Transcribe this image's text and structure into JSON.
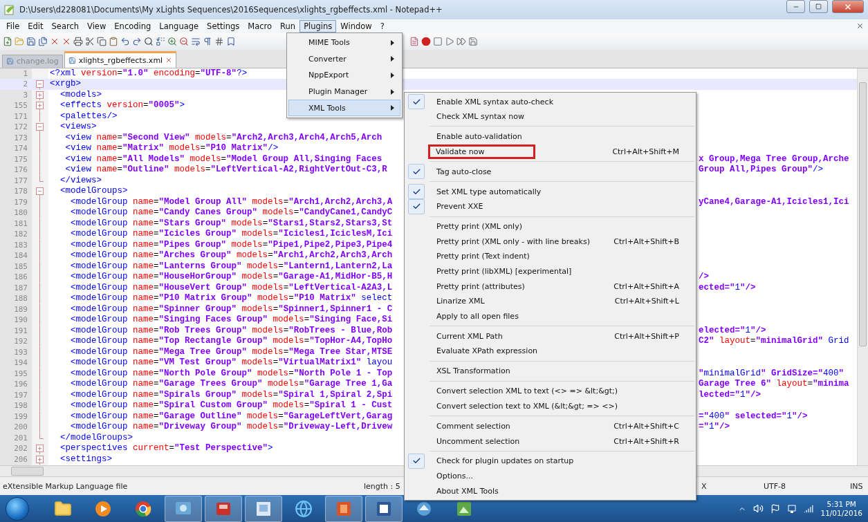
{
  "window": {
    "title": "D:\\Users\\d228081\\Documents\\My xLights Sequences\\2016Sequences\\xlights_rgbeffects.xml - Notepad++"
  },
  "menu_bar": [
    {
      "label": "File",
      "selected": false
    },
    {
      "label": "Edit",
      "selected": false
    },
    {
      "label": "Search",
      "selected": false
    },
    {
      "label": "View",
      "selected": false
    },
    {
      "label": "Encoding",
      "selected": false
    },
    {
      "label": "Language",
      "selected": false
    },
    {
      "label": "Settings",
      "selected": false
    },
    {
      "label": "Macro",
      "selected": false
    },
    {
      "label": "Run",
      "selected": false
    },
    {
      "label": "Plugins",
      "selected": true
    },
    {
      "label": "Window",
      "selected": false
    },
    {
      "label": "?",
      "selected": false
    }
  ],
  "tabs": [
    {
      "label": "change.log",
      "selected": false
    },
    {
      "label": "xlights_rgbeffects.xml",
      "selected": true
    }
  ],
  "editor": {
    "lines": [
      {
        "number": "1",
        "kind": "plain",
        "current": false,
        "text": "<?xml version=\"1.0\" encoding=\"UTF-8\"?>"
      },
      {
        "number": "2",
        "kind": "open",
        "current": true,
        "text": "<xrgb>"
      },
      {
        "number": "3",
        "kind": "closed",
        "current": false,
        "text": "  <models>"
      },
      {
        "number": "155",
        "kind": "closed",
        "current": false,
        "text": "  <effects version=\"0005\">"
      },
      {
        "number": "171",
        "kind": "inner",
        "current": false,
        "text": "  <palettes/>"
      },
      {
        "number": "172",
        "kind": "open",
        "current": false,
        "text": "  <views>"
      },
      {
        "number": "173",
        "kind": "inner",
        "current": false,
        "text": "   <view name=\"Second View\" models=\"Arch2,Arch3,Arch4,Arch5,Arch"
      },
      {
        "number": "174",
        "kind": "inner",
        "current": false,
        "text": "   <view name=\"Matrix\" models=\"P10 Matrix\"/>"
      },
      {
        "number": "175",
        "kind": "inner",
        "current": false,
        "text": "   <view name=\"All Models\" models=\"Model Group All,Singing Faces",
        "right": "x Group,Mega Tree Group,Arche"
      },
      {
        "number": "176",
        "kind": "inner",
        "current": false,
        "text": "   <view name=\"Outline\" models=\"LeftVertical-A2,RightVertOut-C3,R",
        "right": "Group All,Pipes Group\"/>"
      },
      {
        "number": "177",
        "kind": "end",
        "current": false,
        "text": "  </views>"
      },
      {
        "number": "178",
        "kind": "open",
        "current": false,
        "text": "  <modelGroups>"
      },
      {
        "number": "179",
        "kind": "inner",
        "current": false,
        "text": "    <modelGroup name=\"Model Group All\" models=\"Arch1,Arch2,Arch3,A",
        "right": "yCane4,Garage-A1,Icicles1,Ici"
      },
      {
        "number": "180",
        "kind": "inner",
        "current": false,
        "text": "    <modelGroup name=\"Candy Canes Group\" models=\"CandyCane1,CandyC"
      },
      {
        "number": "181",
        "kind": "inner",
        "current": false,
        "text": "    <modelGroup name=\"Stars Group\" models=\"Stars1,Stars2,Stars3,St"
      },
      {
        "number": "182",
        "kind": "inner",
        "current": false,
        "text": "    <modelGroup name=\"Icicles Group\" models=\"Icicles1,IciclesM,Ici"
      },
      {
        "number": "183",
        "kind": "inner",
        "current": false,
        "text": "    <modelGroup name=\"Pipes Group\" models=\"Pipe1,Pipe2,Pipe3,Pipe4"
      },
      {
        "number": "184",
        "kind": "inner",
        "current": false,
        "text": "    <modelGroup name=\"Arches Group\" models=\"Arch1,Arch2,Arch3,Arch"
      },
      {
        "number": "185",
        "kind": "inner",
        "current": false,
        "text": "    <modelGroup name=\"Lanterns Group\" models=\"Lantern1,Lantern2,La"
      },
      {
        "number": "186",
        "kind": "inner",
        "current": false,
        "text": "    <modelGroup name=\"HouseHorGroup\" models=\"Garage-A1,MidHor-B5,H",
        "right": "/>"
      },
      {
        "number": "187",
        "kind": "inner",
        "current": false,
        "text": "    <modelGroup name=\"HouseVert Group\" models=\"LeftVertical-A2A3,L",
        "right": "ected=\"1\"/>"
      },
      {
        "number": "188",
        "kind": "inner",
        "current": false,
        "text": "    <modelGroup name=\"P10 Matrix Group\" models=\"P10 Matrix\" select"
      },
      {
        "number": "189",
        "kind": "inner",
        "current": false,
        "text": "    <modelGroup name=\"Spinner Group\" models=\"Spinner1,Spinner1 - C"
      },
      {
        "number": "190",
        "kind": "inner",
        "current": false,
        "text": "    <modelGroup name=\"Singing Faces Group\" models=\"Singing Face,Si"
      },
      {
        "number": "191",
        "kind": "inner",
        "current": false,
        "text": "    <modelGroup name=\"Rob Trees Group\" models=\"RobTrees - Blue,Rob",
        "right": "elected=\"1\"/>"
      },
      {
        "number": "192",
        "kind": "inner",
        "current": false,
        "text": "    <modelGroup name=\"Top Rectangle Group\" models=\"TopHor-A4,TopHo",
        "right": "C2\" layout=\"minimalGrid\" Grid"
      },
      {
        "number": "193",
        "kind": "inner",
        "current": false,
        "text": "    <modelGroup name=\"Mega Tree Group\" models=\"Mega Tree Star,MTSE"
      },
      {
        "number": "194",
        "kind": "inner",
        "current": false,
        "text": "    <modelGroup name=\"VM Test Group\" models=\"VirtualMatrix1\" layou"
      },
      {
        "number": "195",
        "kind": "inner",
        "current": false,
        "text": "    <modelGroup name=\"North Pole Group\" models=\"North Pole 1 - Top",
        "right": "\"minimalGrid\" GridSize=\"400\""
      },
      {
        "number": "196",
        "kind": "inner",
        "current": false,
        "text": "    <modelGroup name=\"Garage Trees Group\" models=\"Garage Tree 1,Ga",
        "right": "Garage Tree 6\" layout=\"minima"
      },
      {
        "number": "197",
        "kind": "inner",
        "current": false,
        "text": "    <modelGroup name=\"Spirals Group\" models=\"Spiral 1,Spiral 2,Spi",
        "right": "lected=\"1\"/>"
      },
      {
        "number": "198",
        "kind": "inner",
        "current": false,
        "text": "    <modelGroup name=\"Spiral Custom Group\" models=\"Spiral 1 - Cust"
      },
      {
        "number": "199",
        "kind": "inner",
        "current": false,
        "text": "    <modelGroup name=\"Garage Outline\" models=\"GarageLeftVert,Garag",
        "right": "=\"400\" selected=\"1\"/>"
      },
      {
        "number": "200",
        "kind": "inner",
        "current": false,
        "text": "    <modelGroup name=\"Driveway Group\" models=\"Driveway-Left,Drivew",
        "right": "=\"1\"/>"
      },
      {
        "number": "201",
        "kind": "end",
        "current": false,
        "text": "  </modelGroups>"
      },
      {
        "number": "202",
        "kind": "closed",
        "current": false,
        "text": "  <perspectives current=\"Test Perspective\">"
      },
      {
        "number": "206",
        "kind": "closed",
        "current": false,
        "text": "  <settings>"
      }
    ]
  },
  "plugins_menu": {
    "items": [
      {
        "label": "MIME Tools",
        "selected": false
      },
      {
        "label": "Converter",
        "selected": false
      },
      {
        "label": "NppExport",
        "selected": false
      },
      {
        "label": "Plugin Manager",
        "selected": false
      },
      {
        "label": "XML Tools",
        "selected": true
      }
    ]
  },
  "xml_tools_menu": {
    "items": [
      {
        "kind": "item",
        "label": "Enable XML syntax auto-check",
        "checked": true,
        "outlined": false
      },
      {
        "kind": "item",
        "label": "Check XML syntax now",
        "checked": false,
        "outlined": false
      },
      {
        "kind": "separator"
      },
      {
        "kind": "item",
        "label": "Enable auto-validation",
        "checked": false,
        "outlined": false
      },
      {
        "kind": "item",
        "label": "Validate now",
        "shortcut": "Ctrl+Alt+Shift+M",
        "checked": false,
        "outlined": true
      },
      {
        "kind": "separator"
      },
      {
        "kind": "item",
        "label": "Tag auto-close",
        "checked": true,
        "outlined": false
      },
      {
        "kind": "separator"
      },
      {
        "kind": "item",
        "label": "Set XML type automatically",
        "checked": true,
        "outlined": false
      },
      {
        "kind": "item",
        "label": "Prevent XXE",
        "checked": true,
        "outlined": false
      },
      {
        "kind": "separator"
      },
      {
        "kind": "item",
        "label": "Pretty print (XML only)",
        "checked": false,
        "outlined": false
      },
      {
        "kind": "item",
        "label": "Pretty print (XML only - with line breaks)",
        "shortcut": "Ctrl+Alt+Shift+B",
        "checked": false,
        "outlined": false
      },
      {
        "kind": "item",
        "label": "Pretty print (Text indent)",
        "checked": false,
        "outlined": false
      },
      {
        "kind": "item",
        "label": "Pretty print (libXML) [experimental]",
        "checked": false,
        "outlined": false
      },
      {
        "kind": "item",
        "label": "Pretty print (attributes)",
        "shortcut": "Ctrl+Alt+Shift+A",
        "checked": false,
        "outlined": false
      },
      {
        "kind": "item",
        "label": "Linarize XML",
        "shortcut": "Ctrl+Alt+Shift+L",
        "checked": false,
        "outlined": false
      },
      {
        "kind": "item",
        "label": "Apply to all open files",
        "checked": false,
        "outlined": false
      },
      {
        "kind": "separator"
      },
      {
        "kind": "item",
        "label": "Current XML Path",
        "shortcut": "Ctrl+Alt+Shift+P",
        "checked": false,
        "outlined": false
      },
      {
        "kind": "item",
        "label": "Evaluate XPath expression",
        "checked": false,
        "outlined": false
      },
      {
        "kind": "separator"
      },
      {
        "kind": "item",
        "label": "XSL Transformation",
        "checked": false,
        "outlined": false
      },
      {
        "kind": "separator"
      },
      {
        "kind": "item",
        "label": "Convert selection XML to text (<> => &lt;&gt;)",
        "checked": false,
        "outlined": false
      },
      {
        "kind": "item",
        "label": "Convert selection text to XML (&lt;&gt; => <>)",
        "checked": false,
        "outlined": false
      },
      {
        "kind": "separator"
      },
      {
        "kind": "item",
        "label": "Comment selection",
        "shortcut": "Ctrl+Alt+Shift+C",
        "checked": false,
        "outlined": false
      },
      {
        "kind": "item",
        "label": "Uncomment selection",
        "shortcut": "Ctrl+Alt+Shift+R",
        "checked": false,
        "outlined": false
      },
      {
        "kind": "separator"
      },
      {
        "kind": "item",
        "label": "Check for plugin updates on startup",
        "checked": true,
        "outlined": false
      },
      {
        "kind": "item",
        "label": "Options...",
        "checked": false,
        "outlined": false
      },
      {
        "kind": "item",
        "label": "About XML Tools",
        "checked": false,
        "outlined": false
      }
    ]
  },
  "status_bar": {
    "file_type": "eXtensible Markup Language file",
    "length": "length : 5",
    "eol": "X",
    "encoding": "UTF-8",
    "mode": "INS"
  },
  "taskbar": {
    "time": "5:31 PM",
    "date": "11/01/2016"
  }
}
